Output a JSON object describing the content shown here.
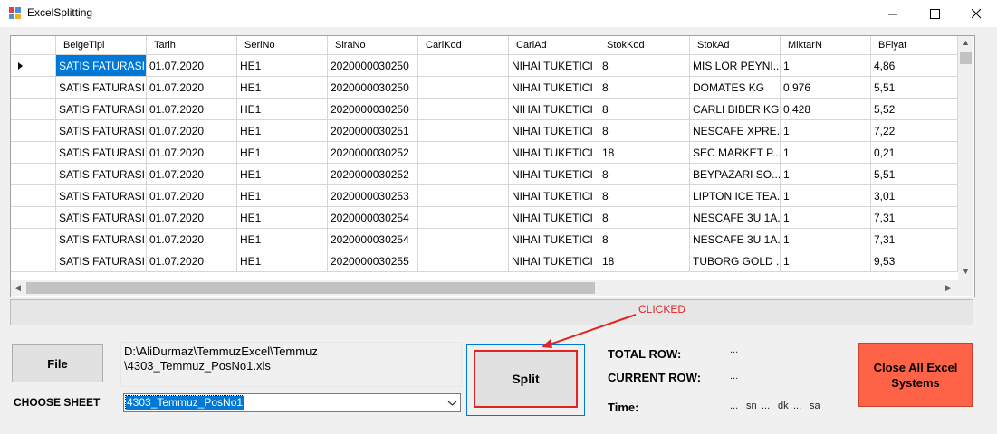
{
  "window": {
    "title": "ExcelSplitting",
    "minimize_glyph": "─",
    "maximize_glyph": "☐",
    "close_glyph": "✕",
    "icon": "app-icon",
    "accent": "#0078d7"
  },
  "grid": {
    "columns": [
      "BelgeTipi",
      "Tarih",
      "SeriNo",
      "SiraNo",
      "CariKod",
      "CariAd",
      "StokKod",
      "StokAd",
      "MiktarN",
      "BFiyat"
    ],
    "rows": [
      [
        "SATIS FATURASI",
        "01.07.2020",
        "HE1",
        "2020000030250",
        "",
        "NIHAI TUKETICI",
        "8",
        "MIS LOR PEYNI...",
        "1",
        "4,86"
      ],
      [
        "SATIS FATURASI",
        "01.07.2020",
        "HE1",
        "2020000030250",
        "",
        "NIHAI TUKETICI",
        "8",
        "DOMATES KG",
        "0,976",
        "5,51"
      ],
      [
        "SATIS FATURASI",
        "01.07.2020",
        "HE1",
        "2020000030250",
        "",
        "NIHAI TUKETICI",
        "8",
        "CARLI BIBER KG",
        "0,428",
        "5,52"
      ],
      [
        "SATIS FATURASI",
        "01.07.2020",
        "HE1",
        "2020000030251",
        "",
        "NIHAI TUKETICI",
        "8",
        "NESCAFE XPRE...",
        "1",
        "7,22"
      ],
      [
        "SATIS FATURASI",
        "01.07.2020",
        "HE1",
        "2020000030252",
        "",
        "NIHAI TUKETICI",
        "18",
        "SEC MARKET P...",
        "1",
        "0,21"
      ],
      [
        "SATIS FATURASI",
        "01.07.2020",
        "HE1",
        "2020000030252",
        "",
        "NIHAI TUKETICI",
        "8",
        "BEYPAZARI SO...",
        "1",
        "5,51"
      ],
      [
        "SATIS FATURASI",
        "01.07.2020",
        "HE1",
        "2020000030253",
        "",
        "NIHAI TUKETICI",
        "8",
        "LIPTON ICE TEA...",
        "1",
        "3,01"
      ],
      [
        "SATIS FATURASI",
        "01.07.2020",
        "HE1",
        "2020000030254",
        "",
        "NIHAI TUKETICI",
        "8",
        "NESCAFE 3U 1A...",
        "1",
        "7,31"
      ],
      [
        "SATIS FATURASI",
        "01.07.2020",
        "HE1",
        "2020000030254",
        "",
        "NIHAI TUKETICI",
        "8",
        "NESCAFE 3U 1A...",
        "1",
        "7,31"
      ],
      [
        "SATIS FATURASI",
        "01.07.2020",
        "HE1",
        "2020000030255",
        "",
        "NIHAI TUKETICI",
        "18",
        "TUBORG GOLD ...",
        "1",
        "9,53"
      ]
    ],
    "selected_row": 0,
    "selected_col": 0
  },
  "controls": {
    "file_button": "File",
    "file_path_line1": "D:\\AliDurmaz\\TemmuzExcel\\Temmuz",
    "file_path_line2": "\\4303_Temmuz_PosNo1.xls",
    "choose_sheet_label": "CHOOSE SHEET",
    "sheet_selected": "4303_Temmuz_PosNo1",
    "split_button": "Split",
    "close_all_line1": "Close All Excel",
    "close_all_line2": "Systems",
    "close_all_color": "#ff6347"
  },
  "stats": {
    "total_row_label": "TOTAL ROW:",
    "total_row_value": "...",
    "current_row_label": "CURRENT ROW:",
    "current_row_value": "...",
    "time_label": "Time:",
    "time_sn_value": "...",
    "time_sn_unit": "sn",
    "time_dk_value": "...",
    "time_dk_unit": "dk",
    "time_sa_value": "...",
    "time_sa_unit": "sa"
  },
  "annotation": {
    "callout_text": "CLICKED",
    "color": "#e32222"
  }
}
